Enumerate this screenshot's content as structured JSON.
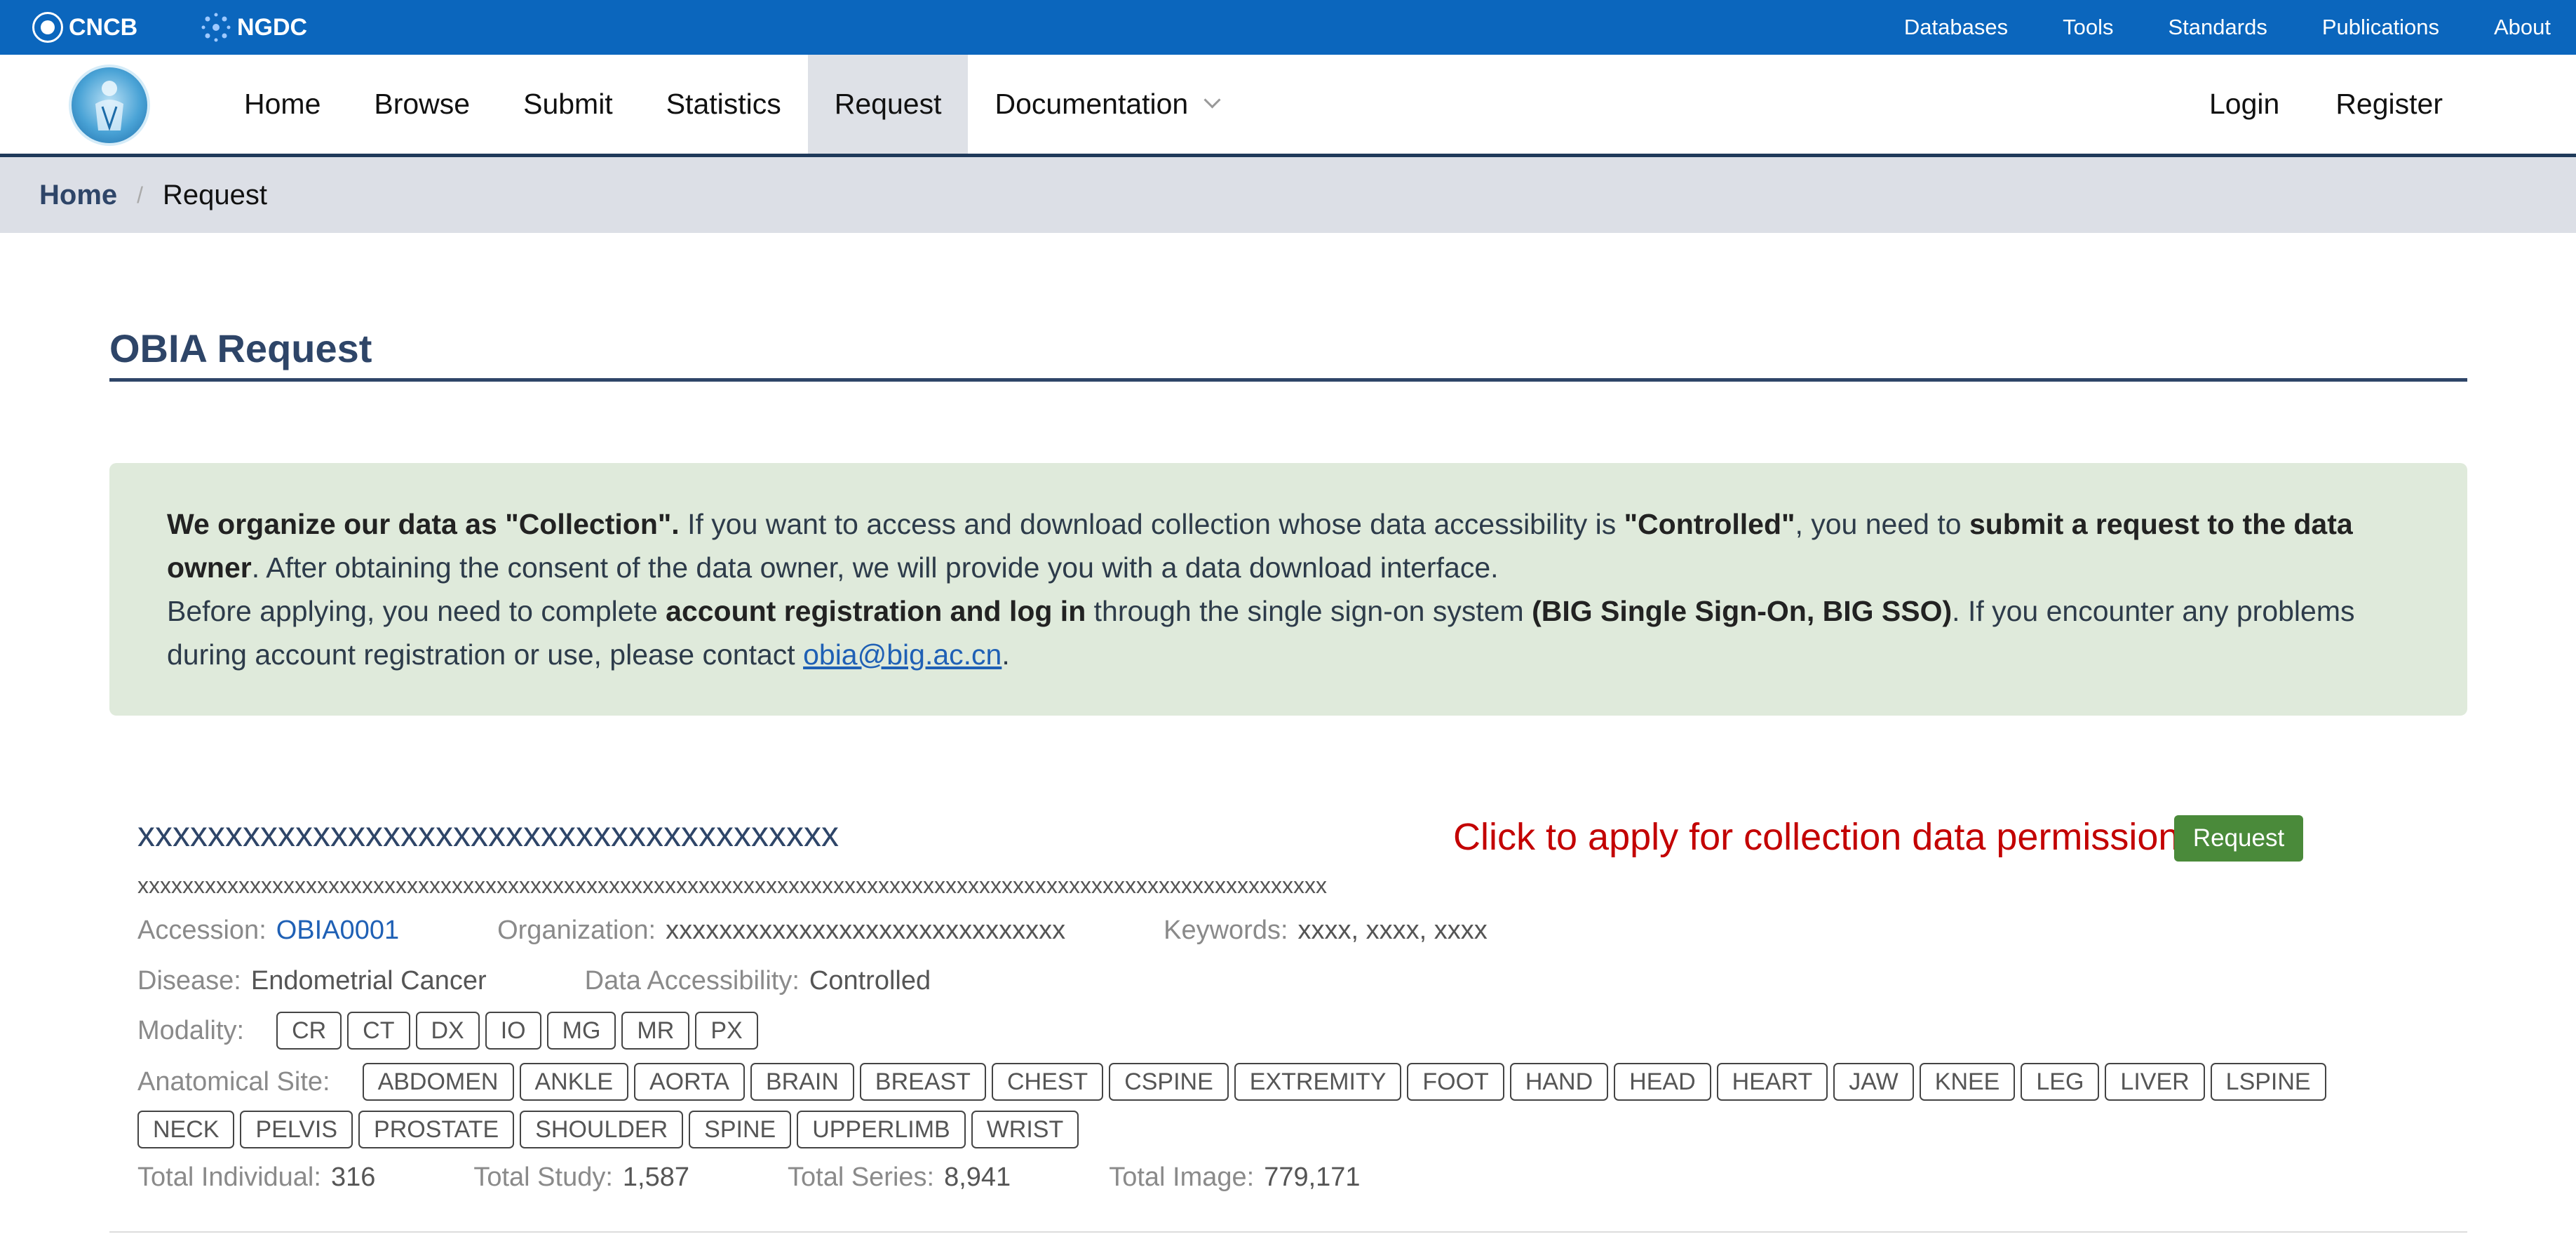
{
  "topbar": {
    "brand1": "CNCB",
    "brand2": "NGDC",
    "links": [
      "Databases",
      "Tools",
      "Standards",
      "Publications",
      "About"
    ]
  },
  "nav": {
    "items": [
      "Home",
      "Browse",
      "Submit",
      "Statistics",
      "Request",
      "Documentation"
    ],
    "active": "Request",
    "login": "Login",
    "register": "Register"
  },
  "breadcrumb": {
    "home": "Home",
    "separator": "/",
    "current": "Request"
  },
  "page_title": "OBIA Request",
  "notice": {
    "s1_bold": "We organize our data as \"Collection\".",
    "s1_text": " If you want to access and download collection whose data accessibility is ",
    "s1_bold2": "\"Controlled\"",
    "s1_text2": ", you need to ",
    "s1_bold3": "submit a request to the data owner",
    "s1_text3": ". After obtaining the consent of the data owner, we will provide you with a data download interface.",
    "s2_text": "Before applying, you need to complete ",
    "s2_bold": "account registration and log in",
    "s2_text2": " through the single sign-on system ",
    "s2_bold2": "(BIG Single Sign-On, BIG SSO)",
    "s2_text3": ". If you encounter any problems during account registration or use, please contact ",
    "email": "obia@big.ac.cn",
    "s2_end": "."
  },
  "collection": {
    "title": "xxxxxxxxxxxxxxxxxxxxxxxxxxxxxxxxxxxxxxxx",
    "description": "xxxxxxxxxxxxxxxxxxxxxxxxxxxxxxxxxxxxxxxxxxxxxxxxxxxxxxxxxxxxxxxxxxxxxxxxxxxxxxxxxxxxxxxxxxxxxxxxxxxxxxxxxx",
    "hint": "Click to apply for collection data permission",
    "request_button": "Request",
    "accession_label": "Accession:",
    "accession": "OBIA0001",
    "organization_label": "Organization:",
    "organization": "xxxxxxxxxxxxxxxxxxxxxxxxxxxxxx",
    "keywords_label": "Keywords:",
    "keywords": "xxxx, xxxx, xxxx",
    "disease_label": "Disease:",
    "disease": "Endometrial Cancer",
    "access_label": "Data Accessibility:",
    "access": "Controlled",
    "modality_label": "Modality:",
    "modalities": [
      "CR",
      "CT",
      "DX",
      "IO",
      "MG",
      "MR",
      "PX"
    ],
    "site_label": "Anatomical Site:",
    "sites_row1": [
      "ABDOMEN",
      "ANKLE",
      "AORTA",
      "BRAIN",
      "BREAST",
      "CHEST",
      "CSPINE",
      "EXTREMITY",
      "FOOT",
      "HAND",
      "HEAD",
      "HEART",
      "JAW",
      "KNEE",
      "LEG",
      "LIVER",
      "LSPINE"
    ],
    "sites_row2": [
      "NECK",
      "PELVIS",
      "PROSTATE",
      "SHOULDER",
      "SPINE",
      "UPPERLIMB",
      "WRIST"
    ],
    "total_individual_label": "Total Individual:",
    "total_individual": "316",
    "total_study_label": "Total Study:",
    "total_study": "1,587",
    "total_series_label": "Total Series:",
    "total_series": "8,941",
    "total_image_label": "Total Image:",
    "total_image": "779,171"
  }
}
